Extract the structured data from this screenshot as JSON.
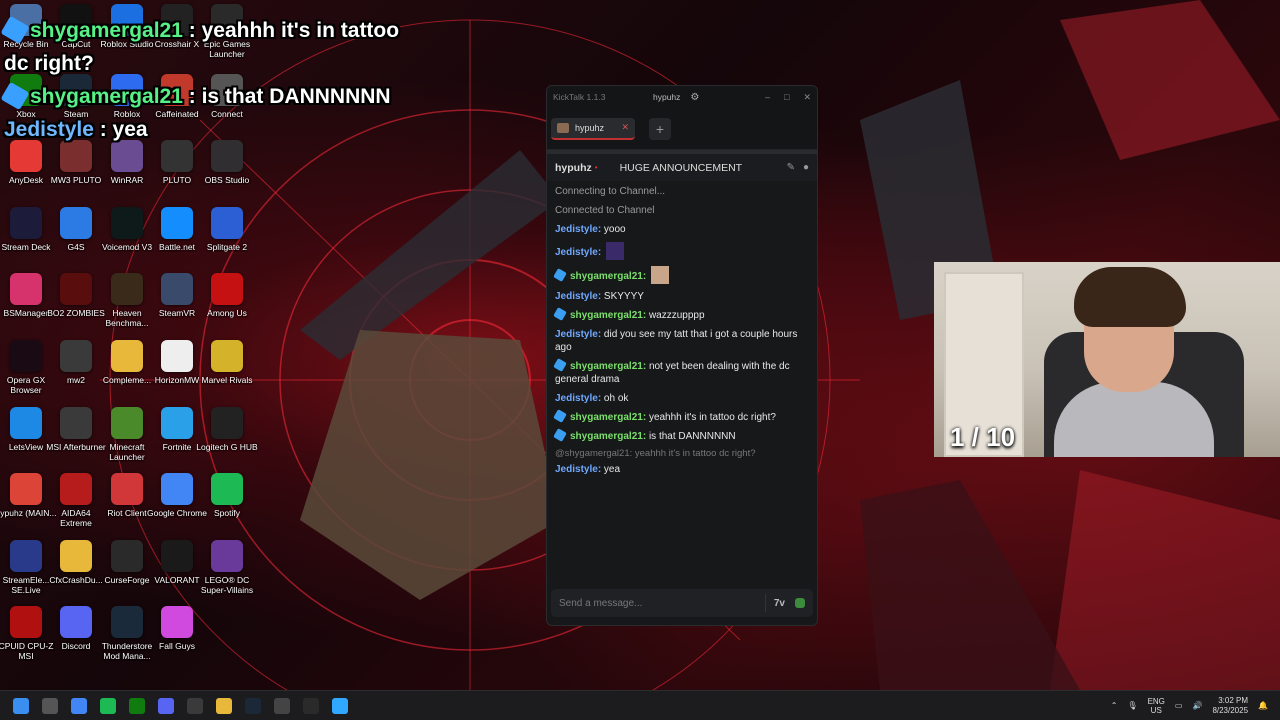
{
  "overlay_chat": [
    {
      "name": "shygamergal21",
      "text": " : yeahhh it's in tattoo",
      "badge": true
    },
    {
      "continuation": "dc right?"
    },
    {
      "name": "shygamergal21",
      "text": " : is that DANNNNNN",
      "badge": true
    },
    {
      "name": "Jedistyle",
      "text": " : yea",
      "badge": false
    }
  ],
  "desktop_icons": [
    {
      "label": "Recycle Bin",
      "icon": "recycle-bin-icon",
      "color": "#4a6fa5"
    },
    {
      "label": "CapCut",
      "icon": "capcut-icon",
      "color": "#111111"
    },
    {
      "label": "Roblox Studio",
      "icon": "roblox-studio-icon",
      "color": "#1b6fe0"
    },
    {
      "label": "Crosshair X",
      "icon": "crosshair-icon",
      "color": "#222222"
    },
    {
      "label": "Epic Games Launcher",
      "icon": "epic-games-icon",
      "color": "#2a2a2a"
    },
    {
      "label": "Xbox",
      "icon": "xbox-icon",
      "color": "#107c10"
    },
    {
      "label": "Steam",
      "icon": "steam-icon",
      "color": "#1b2838"
    },
    {
      "label": "Roblox",
      "icon": "roblox-icon",
      "color": "#2d6cf0"
    },
    {
      "label": "Caffeinated",
      "icon": "caffeinated-icon",
      "color": "#c0392b"
    },
    {
      "label": "Connect",
      "icon": "connect-icon",
      "color": "#555555"
    },
    {
      "label": "AnyDesk",
      "icon": "anydesk-icon",
      "color": "#e53935"
    },
    {
      "label": "MW3 PLUTO",
      "icon": "mw3-pluto-icon",
      "color": "#7a2e2e"
    },
    {
      "label": "WinRAR",
      "icon": "winrar-icon",
      "color": "#6a4c93"
    },
    {
      "label": "PLUTO",
      "icon": "pluto-icon",
      "color": "#333333"
    },
    {
      "label": "OBS Studio",
      "icon": "obs-icon",
      "color": "#302e31"
    },
    {
      "label": "Stream Deck",
      "icon": "stream-deck-icon",
      "color": "#1c1c3a"
    },
    {
      "label": "G4S",
      "icon": "g4s-icon",
      "color": "#2c7be5"
    },
    {
      "label": "Voicemod V3",
      "icon": "voicemod-icon",
      "color": "#0e1a1a"
    },
    {
      "label": "Battle.net",
      "icon": "battlenet-icon",
      "color": "#148eff"
    },
    {
      "label": "Splitgate 2",
      "icon": "splitgate-icon",
      "color": "#2d5fd4"
    },
    {
      "label": "BSManager",
      "icon": "bsmanager-icon",
      "color": "#d6336c"
    },
    {
      "label": "BO2 ZOMBIES",
      "icon": "bo2-zombies-icon",
      "color": "#5a0d0d"
    },
    {
      "label": "Heaven Benchma...",
      "icon": "heaven-benchmark-icon",
      "color": "#3a2a1a"
    },
    {
      "label": "SteamVR",
      "icon": "steamvr-icon",
      "color": "#3a4a6a"
    },
    {
      "label": "Among Us",
      "icon": "among-us-icon",
      "color": "#c51111"
    },
    {
      "label": "Opera GX Browser",
      "icon": "opera-gx-icon",
      "color": "#1a0a14"
    },
    {
      "label": "mw2",
      "icon": "mw2-icon",
      "color": "#3a3a3a"
    },
    {
      "label": "Compleme...",
      "icon": "folder-icon",
      "color": "#e8b83a"
    },
    {
      "label": "HorizonMW",
      "icon": "horizonmw-icon",
      "color": "#eeeeee"
    },
    {
      "label": "Marvel Rivals",
      "icon": "marvel-rivals-icon",
      "color": "#d4b32a"
    },
    {
      "label": "LetsView",
      "icon": "letsview-icon",
      "color": "#1e88e5"
    },
    {
      "label": "MSI Afterburner",
      "icon": "msi-afterburner-icon",
      "color": "#3a3a3a"
    },
    {
      "label": "Minecraft Launcher",
      "icon": "minecraft-icon",
      "color": "#4a8a2a"
    },
    {
      "label": "Fortnite",
      "icon": "fortnite-icon",
      "color": "#2aa0e8"
    },
    {
      "label": "Logitech G HUB",
      "icon": "logitech-icon",
      "color": "#222222"
    },
    {
      "label": "hypuhz (MAIN...",
      "icon": "chrome-profile-icon",
      "color": "#db4437"
    },
    {
      "label": "AIDA64 Extreme",
      "icon": "aida64-icon",
      "color": "#b71c1c"
    },
    {
      "label": "Riot Client",
      "icon": "riot-client-icon",
      "color": "#d13639"
    },
    {
      "label": "Google Chrome",
      "icon": "chrome-icon",
      "color": "#4285f4"
    },
    {
      "label": "Spotify",
      "icon": "spotify-icon",
      "color": "#1db954"
    },
    {
      "label": "StreamEle... SE.Live",
      "icon": "streamelements-icon",
      "color": "#2a3a8a"
    },
    {
      "label": "CfxCrashDu...",
      "icon": "folder-icon",
      "color": "#e8b83a"
    },
    {
      "label": "CurseForge",
      "icon": "curseforge-icon",
      "color": "#2a2a2a"
    },
    {
      "label": "VALORANT",
      "icon": "valorant-icon",
      "color": "#1a1a1a"
    },
    {
      "label": "LEGO® DC Super-Villains",
      "icon": "lego-dc-icon",
      "color": "#6a3a9a"
    },
    {
      "label": "CPUID CPU-Z MSI",
      "icon": "cpuz-icon",
      "color": "#b01010"
    },
    {
      "label": "Discord",
      "icon": "discord-icon",
      "color": "#5865f2"
    },
    {
      "label": "Thunderstore Mod Mana...",
      "icon": "thunderstore-icon",
      "color": "#1a2a3a"
    },
    {
      "label": "Fall Guys",
      "icon": "fall-guys-icon",
      "color": "#d04ae0"
    }
  ],
  "kicktalk": {
    "app_title": "KickTalk 1.1.3",
    "username": "hypuhz",
    "settings_icon": "gear-icon",
    "window_controls": [
      "–",
      "□",
      "✕"
    ],
    "tab": {
      "label": "hypuhz",
      "close": "✕"
    },
    "add_tab": "+",
    "channel": {
      "name": "hypuhz",
      "live_dot": "•",
      "stream_title": "HUGE ANNOUNCEMENT"
    },
    "messages": [
      {
        "type": "system",
        "text": "Connecting to Channel..."
      },
      {
        "type": "system",
        "text": "Connected to Channel"
      },
      {
        "type": "chat",
        "user": "Jedistyle",
        "color": "blue",
        "badge": false,
        "text": "yooo"
      },
      {
        "type": "chat",
        "user": "Jedistyle",
        "color": "blue",
        "badge": false,
        "text": "",
        "emote": "emote-image"
      },
      {
        "type": "chat",
        "user": "shygamergal21",
        "color": "green",
        "badge": true,
        "text": "",
        "emote": "emote-image"
      },
      {
        "type": "chat",
        "user": "Jedistyle",
        "color": "blue",
        "badge": false,
        "text": "SKYYYY"
      },
      {
        "type": "chat",
        "user": "shygamergal21",
        "color": "green",
        "badge": true,
        "text": "wazzzupppp"
      },
      {
        "type": "chat",
        "user": "Jedistyle",
        "color": "blue",
        "badge": false,
        "text": "did you see my tatt that i got a couple hours ago"
      },
      {
        "type": "chat",
        "user": "shygamergal21",
        "color": "green",
        "badge": true,
        "text": "not yet been dealing with the dc general drama"
      },
      {
        "type": "chat",
        "user": "Jedistyle",
        "color": "blue",
        "badge": false,
        "text": "oh ok"
      },
      {
        "type": "chat",
        "user": "shygamergal21",
        "color": "green",
        "badge": true,
        "text": "yeahhh it's in tattoo dc right?"
      },
      {
        "type": "chat",
        "user": "shygamergal21",
        "color": "green",
        "badge": true,
        "text": "is that DANNNNNN"
      },
      {
        "type": "chat",
        "user": "Jedistyle",
        "color": "blue",
        "badge": false,
        "text": "yea",
        "reply_to": "@shygamergal21: yeahhh it's in tattoo dc right?"
      }
    ],
    "input": {
      "placeholder": "Send a message..."
    }
  },
  "webcam": {
    "counter": "1 / 10"
  },
  "taskbar": {
    "icons": [
      "windows-start-icon",
      "task-view-icon",
      "chrome-icon",
      "spotify-icon",
      "xbox-icon",
      "discord-icon",
      "obs-icon",
      "file-explorer-icon",
      "steam-icon",
      "logitech-icon",
      "epic-games-icon",
      "photoshop-icon"
    ],
    "lang_top": "ENG",
    "lang_bottom": "US",
    "time": "3:02 PM",
    "date": "8/23/2025"
  },
  "colors": {
    "accent_green": "#7ae06a",
    "accent_blue": "#6fa8ff",
    "kick_red": "#c03030"
  }
}
